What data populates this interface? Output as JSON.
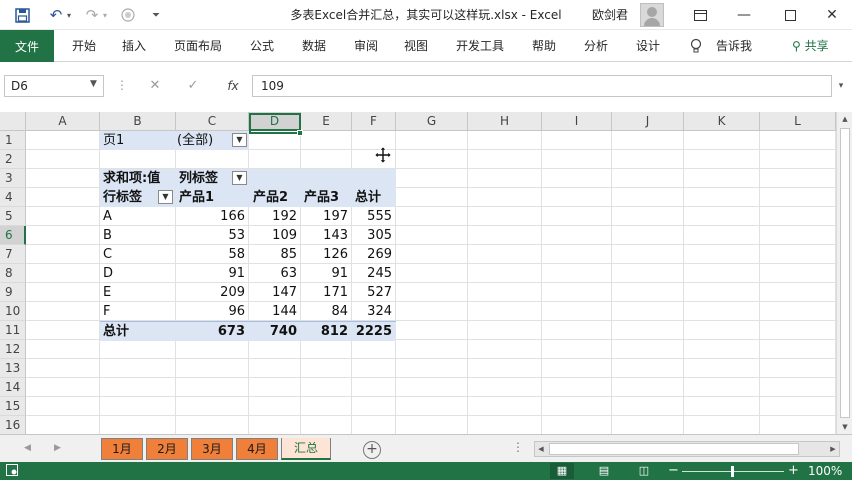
{
  "window": {
    "title": "多表Excel合并汇总，其实可以这样玩.xlsx  -  Excel",
    "user": "欧剑君",
    "quick_access": [
      "save-icon",
      "undo-icon",
      "redo-icon",
      "touch-mode-icon",
      "customize-icon"
    ]
  },
  "ribbon": {
    "file_tab": "文件",
    "tabs": [
      "开始",
      "插入",
      "页面布局",
      "公式",
      "数据",
      "审阅",
      "视图",
      "开发工具",
      "帮助",
      "分析",
      "设计"
    ],
    "tell_me": "告诉我",
    "share": "共享"
  },
  "formula_bar": {
    "name_box": "D6",
    "fx": "fx",
    "value": "109"
  },
  "grid": {
    "columns": [
      "A",
      "B",
      "C",
      "D",
      "E",
      "F",
      "G",
      "H",
      "I",
      "J",
      "K",
      "L"
    ],
    "rows": [
      "1",
      "2",
      "3",
      "4",
      "5",
      "6",
      "7",
      "8",
      "9",
      "10",
      "11",
      "12",
      "13",
      "14",
      "15",
      "16"
    ],
    "active_cell": "D6"
  },
  "pivot": {
    "page_field": "页1",
    "page_value": "(全部)",
    "value_label": "求和项:值",
    "col_labels": "列标签",
    "row_labels": "行标签",
    "col_headers": [
      "产品1",
      "产品2",
      "产品3",
      "总计"
    ],
    "rows": [
      {
        "label": "A",
        "values": [
          "166",
          "192",
          "197",
          "555"
        ]
      },
      {
        "label": "B",
        "values": [
          "53",
          "109",
          "143",
          "305"
        ]
      },
      {
        "label": "C",
        "values": [
          "58",
          "85",
          "126",
          "269"
        ]
      },
      {
        "label": "D",
        "values": [
          "91",
          "63",
          "91",
          "245"
        ]
      },
      {
        "label": "E",
        "values": [
          "209",
          "147",
          "171",
          "527"
        ]
      },
      {
        "label": "F",
        "values": [
          "96",
          "144",
          "84",
          "324"
        ]
      }
    ],
    "total": {
      "label": "总计",
      "values": [
        "673",
        "740",
        "812",
        "2225"
      ]
    }
  },
  "sheets": {
    "tabs": [
      "1月",
      "2月",
      "3月",
      "4月",
      "汇总"
    ],
    "active": "汇总",
    "tab_color": "#f07f3a"
  },
  "status": {
    "zoom": "100%"
  },
  "colors": {
    "accent": "#217346",
    "pivot_band": "#dbe5f4"
  }
}
